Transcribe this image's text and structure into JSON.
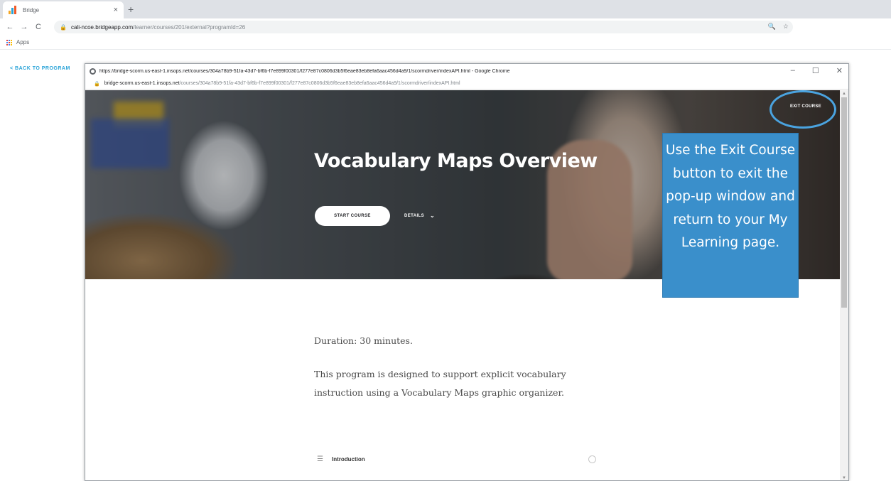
{
  "browser": {
    "tab_title": "Bridge",
    "tab_close": "×",
    "new_tab": "+",
    "back": "←",
    "forward": "→",
    "reload": "C",
    "lock": "🔒",
    "url_host": "cali-ncoe.bridgeapp.com",
    "url_path": "/learner/courses/201/external?programId=26",
    "zoom_icon": "🔍",
    "star_icon": "☆",
    "bookmark_apps": "Apps"
  },
  "page": {
    "back_link": "< BACK TO PROGRAM"
  },
  "popup": {
    "title": "https://bridge-scorm.us-east-1.insops.net/courses/304a78b9-51fa-43d7-bf6b-f7e899f00301/f277e87c0806d3b5f6eae83eb8efa6aac456d4a9/1/scormdriver/indexAPI.html - Google Chrome",
    "minimize": "–",
    "maximize": "☐",
    "close": "✕",
    "url_host": "bridge-scorm.us-east-1.insops.net",
    "url_path": "/courses/304a78b9-51fa-43d7-bf6b-f7e899f00301/f277e87c0806d3b5f6eae83eb8efa6aac456d4a9/1/scormdriver/indexAPI.html"
  },
  "course": {
    "title": "Vocabulary Maps Overview",
    "start_button": "START COURSE",
    "details_button": "DETAILS",
    "details_chevron": "⌄",
    "exit_button": "EXIT COURSE",
    "duration": "Duration: 30 minutes.",
    "description": "This program is designed to support explicit vocabulary instruction using a Vocabulary Maps graphic organizer.",
    "lesson_icon": "☰",
    "lesson_title": "Introduction"
  },
  "callout": {
    "text": "Use the Exit Course button to exit the pop-up window and return to your My Learning page."
  },
  "scroll": {
    "up": "▲",
    "down": "▼"
  }
}
